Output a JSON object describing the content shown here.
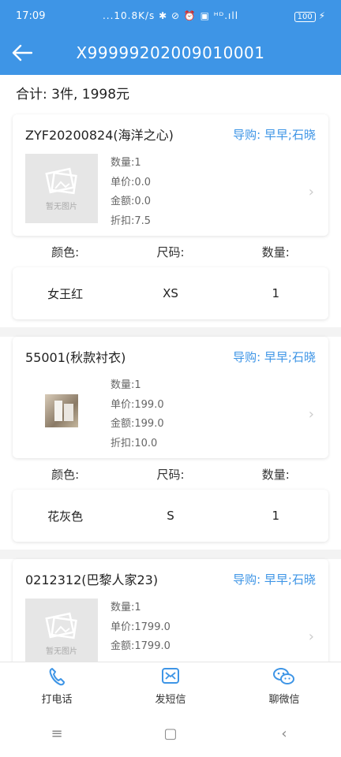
{
  "status": {
    "time": "17:09",
    "center": "...10.8K/s ✱ ⊘ ⏰ ▣ ᴴᴰ.ıll",
    "battery": "100"
  },
  "nav": {
    "title": "X99999202009010001",
    "back_icon": "back-arrow-icon"
  },
  "summary": "合计: 3件, 1998元",
  "spec_headers": {
    "color": "颜色:",
    "size": "尺码:",
    "qty": "数量:"
  },
  "items": [
    {
      "name": "ZYF20200824(海洋之心)",
      "guide": "导购: 早早;石晓",
      "image": "placeholder",
      "image_label": "暂无图片",
      "qty": "数量:1",
      "price": "单价:0.0",
      "amount": "金额:0.0",
      "discount": "折扣:7.5",
      "spec": {
        "color": "女王红",
        "size": "XS",
        "qty": "1"
      }
    },
    {
      "name": "55001(秋款衬衣)",
      "guide": "导购: 早早;石晓",
      "image": "photo",
      "qty": "数量:1",
      "price": "单价:199.0",
      "amount": "金额:199.0",
      "discount": "折扣:10.0",
      "spec": {
        "color": "花灰色",
        "size": "S",
        "qty": "1"
      }
    },
    {
      "name": "0212312(巴黎人家23)",
      "guide": "导购: 早早;石晓",
      "image": "placeholder",
      "image_label": "暂无图片",
      "qty": "数量:1",
      "price": "单价:1799.0",
      "amount": "金额:1799.0",
      "discount": ""
    }
  ],
  "bottom": {
    "call": "打电话",
    "sms": "发短信",
    "wechat": "聊微信"
  },
  "colors": {
    "primary": "#3e95e6"
  }
}
